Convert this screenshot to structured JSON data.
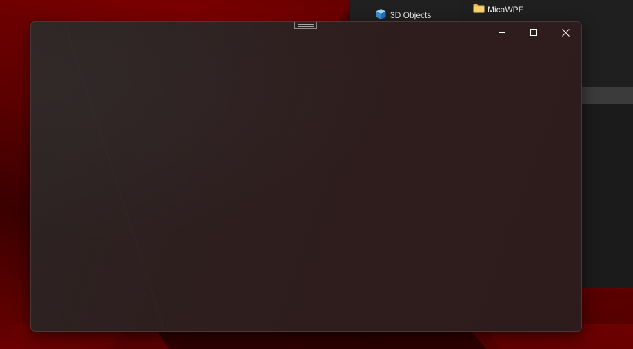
{
  "background_window": {
    "nav_item": {
      "label": "3D Objects",
      "icon": "cube-3d-icon"
    },
    "file_item": {
      "label": "MicaWPF",
      "icon": "folder-icon"
    }
  },
  "main_window": {
    "caption_buttons": [
      {
        "icon": "minimize-icon"
      },
      {
        "icon": "maximize-icon"
      },
      {
        "icon": "close-icon"
      }
    ]
  },
  "colors": {
    "desktop_accent": "#7a0000",
    "window_tint": "#2e1f1f",
    "caption_glyph": "#ffffff"
  }
}
